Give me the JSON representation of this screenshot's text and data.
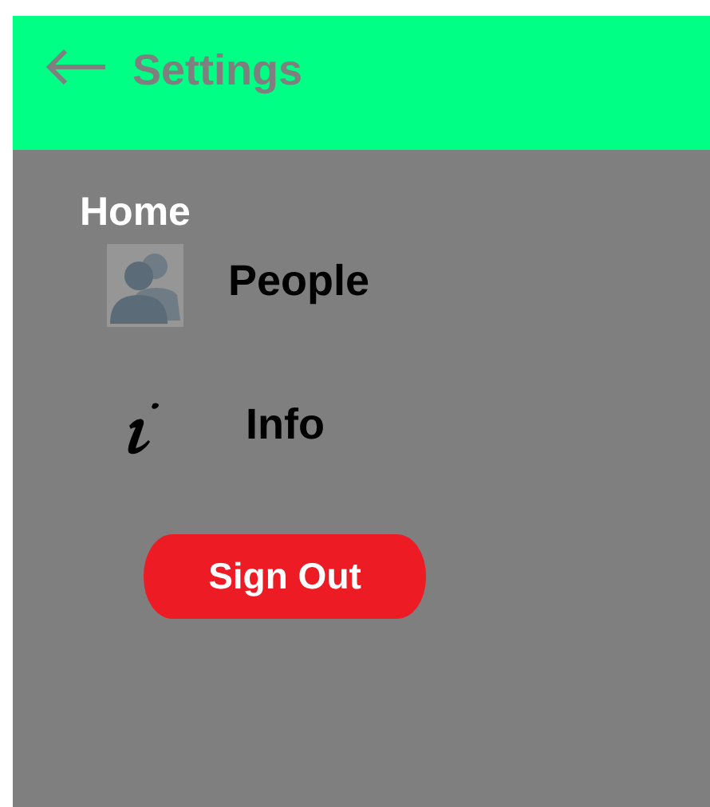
{
  "header": {
    "title": "Settings"
  },
  "section": {
    "title": "Home"
  },
  "items": [
    {
      "kind": "people",
      "label": "People"
    },
    {
      "kind": "info",
      "label": "Info"
    }
  ],
  "sign_out": {
    "label": "Sign Out"
  }
}
